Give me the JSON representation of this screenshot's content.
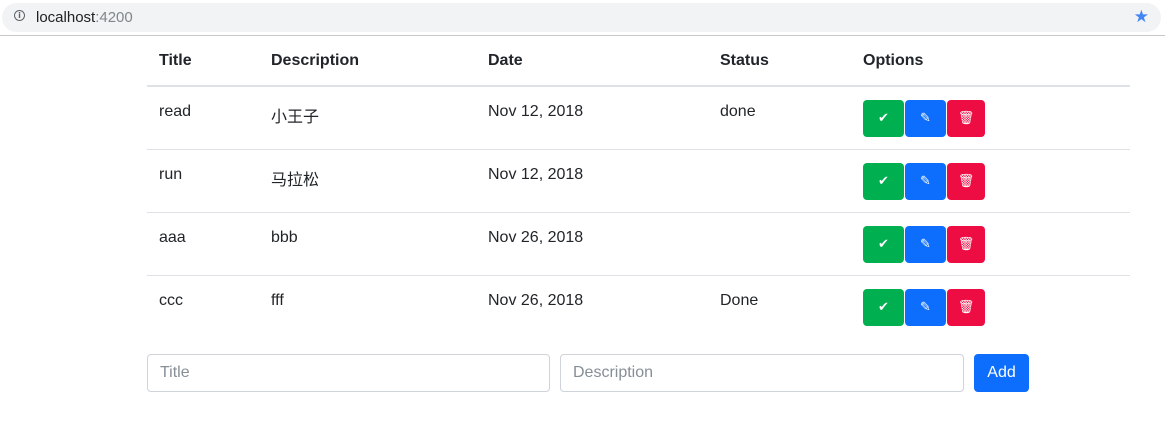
{
  "browser": {
    "url_host": "localhost",
    "url_port": ":4200",
    "info_icon": "info-icon",
    "star_icon": "star-icon",
    "star_color": "#4285f4"
  },
  "table": {
    "headers": [
      "Title",
      "Description",
      "Date",
      "Status",
      "Options"
    ],
    "rows": [
      {
        "title": "read",
        "description": "小王子",
        "date": "Nov 12, 2018",
        "status": "done"
      },
      {
        "title": "run",
        "description": "马拉松",
        "date": "Nov 12, 2018",
        "status": ""
      },
      {
        "title": "aaa",
        "description": "bbb",
        "date": "Nov 26, 2018",
        "status": ""
      },
      {
        "title": "ccc",
        "description": "fff",
        "date": "Nov 26, 2018",
        "status": "Done"
      }
    ],
    "option_icons": {
      "done": "check-icon",
      "edit": "pencil-icon",
      "delete": "trash-icon"
    },
    "colors": {
      "done": "#00b050",
      "edit": "#0d6efd",
      "delete": "#ee0d43"
    }
  },
  "form": {
    "title_placeholder": "Title",
    "title_value": "",
    "description_placeholder": "Description",
    "description_value": "",
    "add_label": "Add"
  }
}
